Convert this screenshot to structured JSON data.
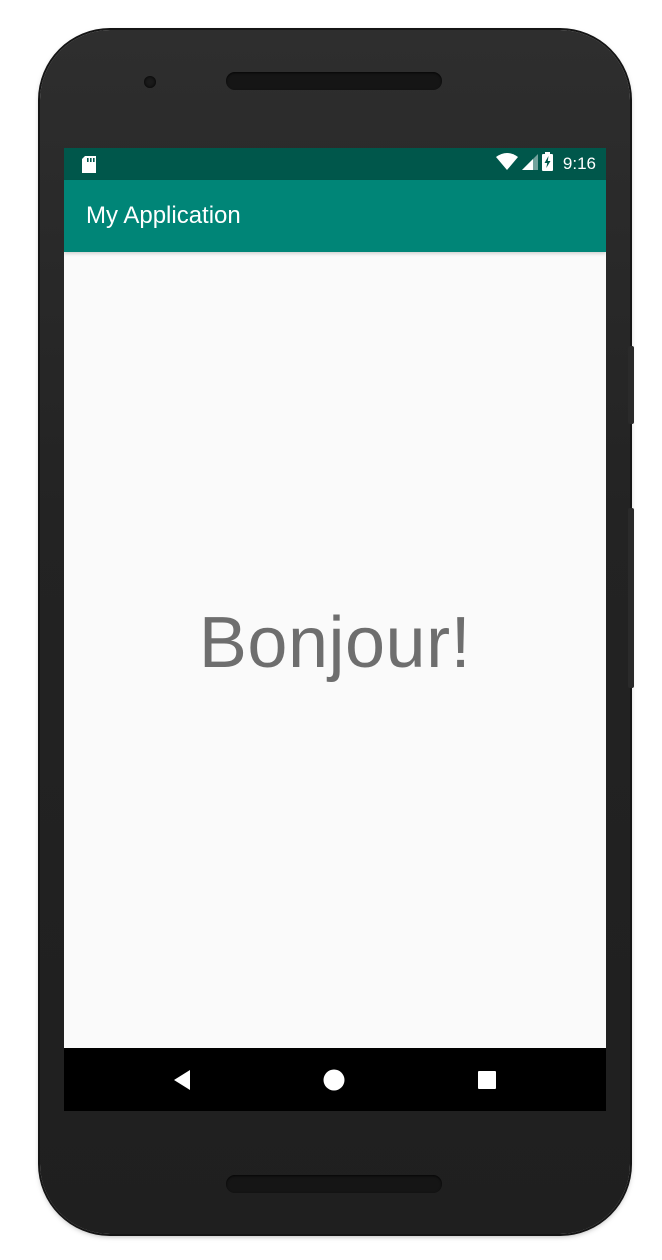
{
  "status_bar": {
    "time": "9:16",
    "icons": [
      "sd-card-icon",
      "wifi-icon",
      "cellular-signal-icon",
      "battery-charging-icon"
    ]
  },
  "app_bar": {
    "title": "My Application"
  },
  "content": {
    "greeting": "Bonjour!"
  },
  "nav_bar": {
    "buttons": [
      "back-icon",
      "home-icon",
      "recents-icon"
    ]
  },
  "colors": {
    "status_bar": "#00574b",
    "app_bar": "#008577",
    "background": "#fafafa",
    "greeting_text": "#6e6e6e",
    "nav_bar": "#000000"
  }
}
